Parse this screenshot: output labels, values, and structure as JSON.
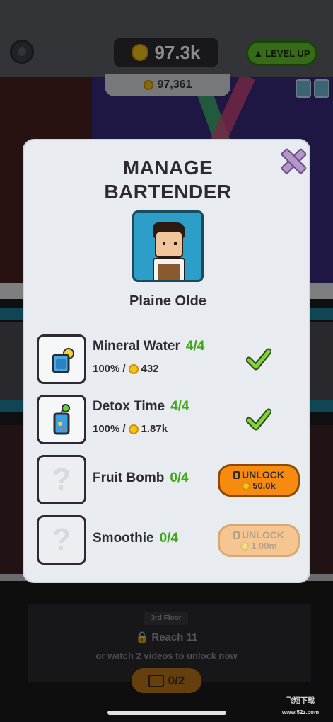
{
  "hud": {
    "cash": "97.3k",
    "sub_cash": "97,361",
    "level_up_label": "LEVEL UP",
    "settings_icon": "gear-icon",
    "coin_color": "#f4c21c"
  },
  "modal": {
    "title_line1": "MANAGE",
    "title_line2": "BARTENDER",
    "bartender_name": "Plaine Olde",
    "close_icon": "close-x-icon",
    "drinks": [
      {
        "name": "Mineral Water",
        "level": "4/4",
        "percent": "100%",
        "price": "432",
        "status": "maxed"
      },
      {
        "name": "Detox Time",
        "level": "4/4",
        "percent": "100%",
        "price": "1.87k",
        "status": "maxed"
      },
      {
        "name": "Fruit Bomb",
        "level": "0/4",
        "unlock_label": "UNLOCK",
        "unlock_price": "50.0k",
        "status": "unlockable"
      },
      {
        "name": "Smoothie",
        "level": "0/4",
        "unlock_label": "UNLOCK",
        "unlock_price": "1.00m",
        "status": "unaffordable"
      }
    ],
    "locked_placeholder": "?"
  },
  "floor": {
    "tag": "3rd Floor",
    "reach_text": "Reach 11",
    "watch_text": "or watch 2 videos to unlock now",
    "video_progress": "0/2"
  },
  "watermark": {
    "line1": "飞翔下载",
    "line2": "www.52z.com"
  }
}
